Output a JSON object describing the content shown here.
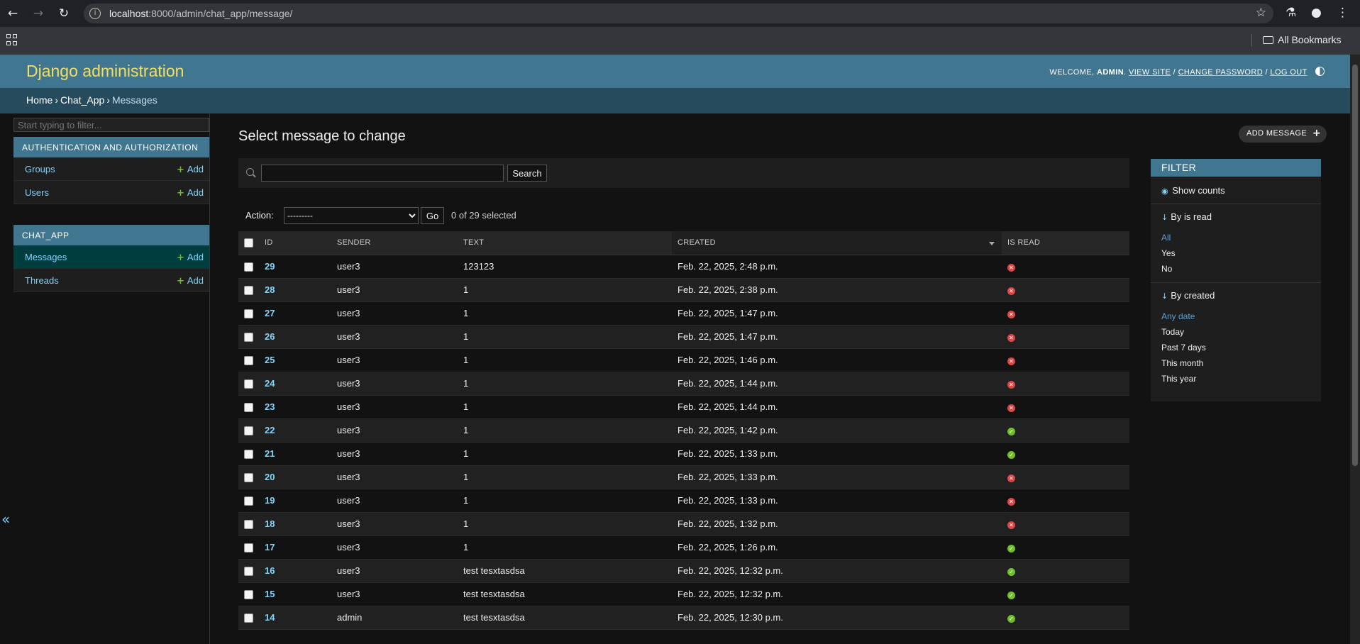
{
  "browser": {
    "url_host": "localhost",
    "url_path": ":8000/admin/chat_app/message/",
    "bookmarks_label": "All Bookmarks"
  },
  "header": {
    "brand": "Django administration",
    "welcome": "WELCOME,",
    "username": "ADMIN",
    "view_site": "VIEW SITE",
    "change_password": "CHANGE PASSWORD",
    "log_out": "LOG OUT"
  },
  "breadcrumbs": [
    "Home",
    "Chat_App",
    "Messages"
  ],
  "sidebar": {
    "filter_placeholder": "Start typing to filter...",
    "add_label": "Add",
    "modules": [
      {
        "caption": "AUTHENTICATION AND AUTHORIZATION",
        "models": [
          "Groups",
          "Users"
        ]
      },
      {
        "caption": "CHAT_APP",
        "models": [
          "Messages",
          "Threads"
        ]
      }
    ],
    "collapse": "«"
  },
  "content": {
    "title": "Select message to change",
    "add_button": "ADD MESSAGE",
    "search_button": "Search",
    "search_value": "",
    "action_label": "Action:",
    "action_selected": "---------",
    "go_button": "Go",
    "selection_counter": "0 of 29 selected"
  },
  "table": {
    "columns": [
      "ID",
      "SENDER",
      "TEXT",
      "CREATED",
      "IS READ"
    ],
    "sorted_column": "CREATED",
    "rows": [
      {
        "id": "29",
        "sender": "user3",
        "text": "123123",
        "created": "Feb. 22, 2025, 2:48 p.m.",
        "is_read": false
      },
      {
        "id": "28",
        "sender": "user3",
        "text": "1",
        "created": "Feb. 22, 2025, 2:38 p.m.",
        "is_read": false
      },
      {
        "id": "27",
        "sender": "user3",
        "text": "1",
        "created": "Feb. 22, 2025, 1:47 p.m.",
        "is_read": false
      },
      {
        "id": "26",
        "sender": "user3",
        "text": "1",
        "created": "Feb. 22, 2025, 1:47 p.m.",
        "is_read": false
      },
      {
        "id": "25",
        "sender": "user3",
        "text": "1",
        "created": "Feb. 22, 2025, 1:46 p.m.",
        "is_read": false
      },
      {
        "id": "24",
        "sender": "user3",
        "text": "1",
        "created": "Feb. 22, 2025, 1:44 p.m.",
        "is_read": false
      },
      {
        "id": "23",
        "sender": "user3",
        "text": "1",
        "created": "Feb. 22, 2025, 1:44 p.m.",
        "is_read": false
      },
      {
        "id": "22",
        "sender": "user3",
        "text": "1",
        "created": "Feb. 22, 2025, 1:42 p.m.",
        "is_read": true
      },
      {
        "id": "21",
        "sender": "user3",
        "text": "1",
        "created": "Feb. 22, 2025, 1:33 p.m.",
        "is_read": true
      },
      {
        "id": "20",
        "sender": "user3",
        "text": "1",
        "created": "Feb. 22, 2025, 1:33 p.m.",
        "is_read": false
      },
      {
        "id": "19",
        "sender": "user3",
        "text": "1",
        "created": "Feb. 22, 2025, 1:33 p.m.",
        "is_read": false
      },
      {
        "id": "18",
        "sender": "user3",
        "text": "1",
        "created": "Feb. 22, 2025, 1:32 p.m.",
        "is_read": false
      },
      {
        "id": "17",
        "sender": "user3",
        "text": "1",
        "created": "Feb. 22, 2025, 1:26 p.m.",
        "is_read": true
      },
      {
        "id": "16",
        "sender": "user3",
        "text": "test tesxtasdsa",
        "created": "Feb. 22, 2025, 12:32 p.m.",
        "is_read": true
      },
      {
        "id": "15",
        "sender": "user3",
        "text": "test tesxtasdsa",
        "created": "Feb. 22, 2025, 12:32 p.m.",
        "is_read": true
      },
      {
        "id": "14",
        "sender": "admin",
        "text": "test tesxtasdsa",
        "created": "Feb. 22, 2025, 12:30 p.m.",
        "is_read": true
      }
    ]
  },
  "filter": {
    "caption": "FILTER",
    "show_counts": "Show counts",
    "groups": [
      {
        "heading": "By is read",
        "options": [
          "All",
          "Yes",
          "No"
        ],
        "selected": "All"
      },
      {
        "heading": "By created",
        "options": [
          "Any date",
          "Today",
          "Past 7 days",
          "This month",
          "This year"
        ],
        "selected": "Any date"
      }
    ]
  },
  "colors": {
    "header_bg": "#417690",
    "brand": "#f5dd5d",
    "breadcrumbs_bg": "#264b5d",
    "link": "#81d4fa",
    "current_model_bg": "#003d3f",
    "bool_yes": "#70bf2b",
    "bool_no": "#dd4646"
  }
}
